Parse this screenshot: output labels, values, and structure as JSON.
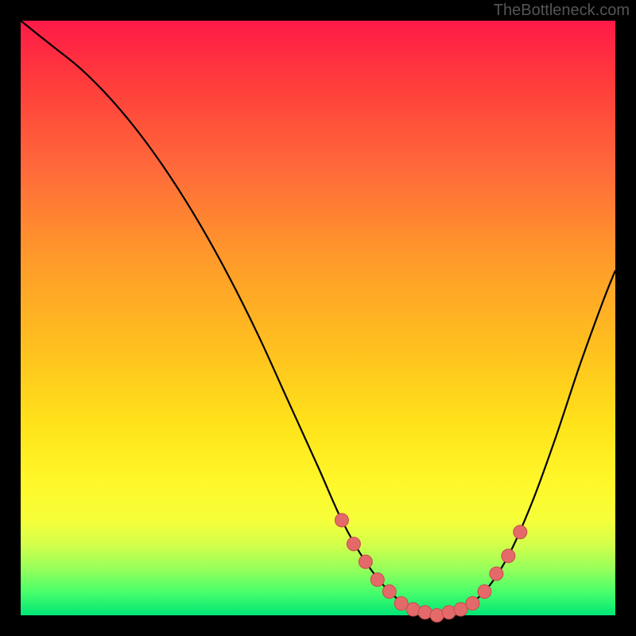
{
  "watermark": "TheBottleneck.com",
  "colors": {
    "background": "#000000",
    "gradient_top": "#ff1a48",
    "gradient_bottom": "#00e676",
    "curve": "#000000",
    "marker_fill": "#e46a6a",
    "marker_stroke": "#ca4a4a"
  },
  "chart_data": {
    "type": "line",
    "title": "",
    "xlabel": "",
    "ylabel": "",
    "xlim": [
      0,
      100
    ],
    "ylim": [
      0,
      100
    ],
    "series": [
      {
        "name": "curve",
        "x": [
          0,
          5,
          10,
          15,
          20,
          25,
          30,
          35,
          40,
          45,
          50,
          54,
          58,
          62,
          66,
          70,
          74,
          78,
          82,
          86,
          90,
          94,
          98,
          100
        ],
        "y": [
          100,
          96,
          92,
          87,
          81,
          74,
          66,
          57,
          47,
          36,
          25,
          16,
          9,
          4,
          1,
          0,
          1,
          4,
          10,
          19,
          30,
          42,
          53,
          58
        ]
      }
    ],
    "markers": {
      "name": "highlight-points",
      "x": [
        54,
        56,
        58,
        60,
        62,
        64,
        66,
        68,
        70,
        72,
        74,
        76,
        78,
        80,
        82,
        84
      ],
      "y": [
        16,
        12,
        9,
        6,
        4,
        2,
        1,
        0.5,
        0,
        0.5,
        1,
        2,
        4,
        7,
        10,
        14
      ]
    }
  }
}
